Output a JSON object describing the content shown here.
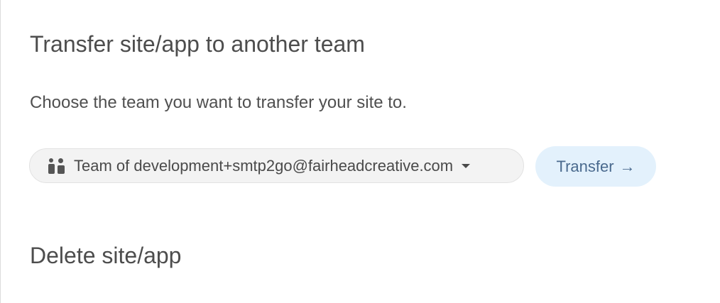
{
  "transfer_section": {
    "title": "Transfer site/app to another team",
    "description": "Choose the team you want to transfer your site to.",
    "team_select": {
      "icon": "team-icon",
      "selected_value": "Team of development+smtp2go@fairheadcreative.com",
      "chevron_icon": "chevron-down-icon"
    },
    "transfer_button": {
      "label": "Transfer",
      "icon": "arrow-right-icon",
      "icon_glyph": "→"
    }
  },
  "delete_section": {
    "title": "Delete site/app"
  },
  "colors": {
    "button_bg": "#e3f1fc",
    "button_text": "#4a6a8e",
    "select_bg": "#f3f3f3"
  }
}
